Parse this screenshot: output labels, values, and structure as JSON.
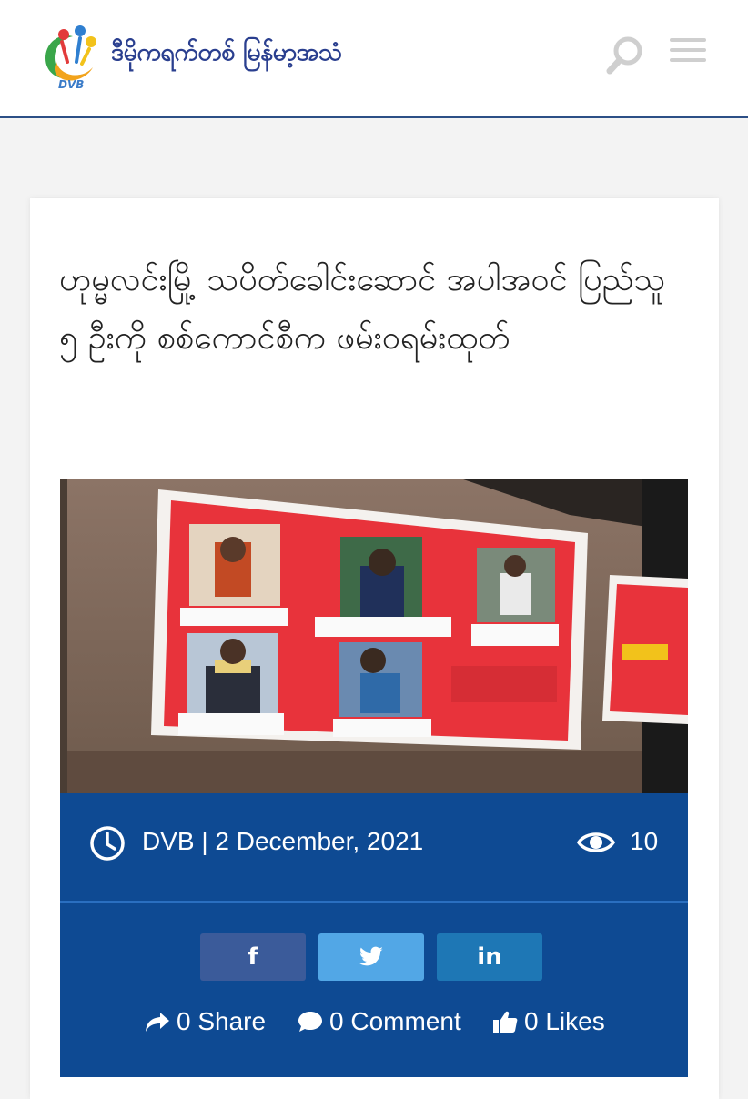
{
  "header": {
    "logo_text": "ဒီမိုကရက်တစ် မြန်မာ့အသံ",
    "logo_sub": "DVB"
  },
  "article": {
    "title": "ဟုမ္မလင်းမြို့ သပိတ်ခေါင်းဆောင် အပါအဝင် ပြည်သူ ၅ ဦးကို စစ်ကောင်စီက ဖမ်းဝရမ်းထုတ်",
    "author_date": "DVB | 2 December, 2021",
    "views": "10"
  },
  "share": {
    "facebook_glyph": "f",
    "linkedin_glyph": "in",
    "share_label": "0 Share",
    "comment_label": "0 Comment",
    "likes_label": "0 Likes"
  },
  "colors": {
    "meta_bg": "#0e4a93",
    "facebook": "#3b5b9a",
    "twitter": "#52a7e6",
    "linkedin": "#1e77b5"
  },
  "icons": [
    "search-icon",
    "menu-icon",
    "clock-icon",
    "eye-icon",
    "share-arrow-icon",
    "comment-icon",
    "thumbs-up-icon",
    "facebook-icon",
    "twitter-icon",
    "linkedin-icon"
  ]
}
